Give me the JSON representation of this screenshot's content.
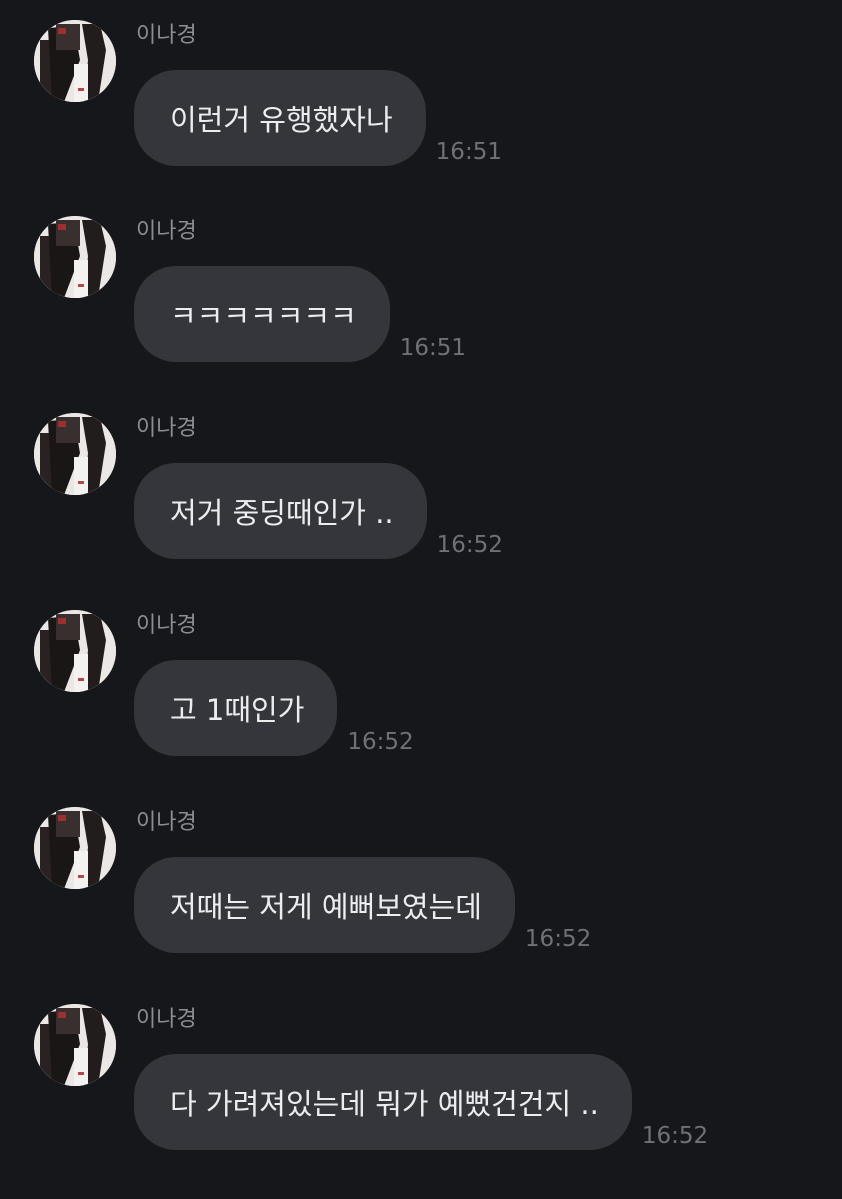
{
  "chat": {
    "messages": [
      {
        "sender": "이나경",
        "text": "이런거 유행했자나",
        "time": "16:51"
      },
      {
        "sender": "이나경",
        "text": "ㅋㅋㅋㅋㅋㅋㅋ",
        "time": "16:51"
      },
      {
        "sender": "이나경",
        "text": "저거 중딩때인가 ..",
        "time": "16:52"
      },
      {
        "sender": "이나경",
        "text": "고 1때인가",
        "time": "16:52"
      },
      {
        "sender": "이나경",
        "text": "저때는 저게 예뻐보였는데",
        "time": "16:52"
      },
      {
        "sender": "이나경",
        "text": "다 가려져있는데 뭐가 예뻤건건지 ..",
        "time": "16:52"
      }
    ]
  },
  "colors": {
    "background": "#16171b",
    "bubble": "#34363c",
    "text": "#ecedef",
    "sender": "#8b8d94",
    "time": "#6f7178"
  },
  "icons": {
    "avatar": "profile-photo"
  }
}
